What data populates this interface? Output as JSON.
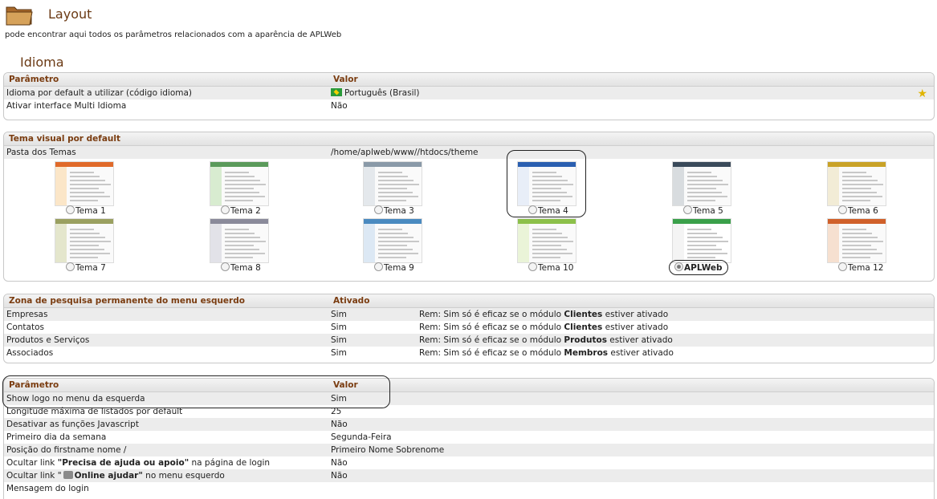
{
  "page": {
    "title": "Layout",
    "description": "pode encontrar aqui todos os parâmetros relacionados com a aparência de APLWeb",
    "section_title": "Idioma"
  },
  "idioma": {
    "header": {
      "param": "Parâmetro",
      "value": "Valor"
    },
    "rows": [
      {
        "label": "Idioma por default a utilizar (código idioma)",
        "value": "Português (Brasil)"
      },
      {
        "label": "Ativar interface Multi Idioma",
        "value": "Não"
      }
    ]
  },
  "tema": {
    "header": "Tema visual por default",
    "folder_label": "Pasta dos Temas",
    "folder_value": "/home/aplweb/www//htdocs/theme",
    "themes": [
      {
        "label": "Tema 1",
        "selected": false,
        "bar": "#e06a2a",
        "side": "#fbe6c8"
      },
      {
        "label": "Tema 2",
        "selected": false,
        "bar": "#5a9a5a",
        "side": "#d8ecd0"
      },
      {
        "label": "Tema 3",
        "selected": false,
        "bar": "#8a9aa8",
        "side": "#e4e8ec"
      },
      {
        "label": "Tema 4",
        "selected": false,
        "bar": "#2a5fb0",
        "side": "#e8eef8"
      },
      {
        "label": "Tema 5",
        "selected": false,
        "bar": "#3a4a5a",
        "side": "#d8dcdf"
      },
      {
        "label": "Tema 6",
        "selected": false,
        "bar": "#c9a227",
        "side": "#f2ecd6"
      },
      {
        "label": "Tema 7",
        "selected": false,
        "bar": "#9aa060",
        "side": "#e4e6cc"
      },
      {
        "label": "Tema 8",
        "selected": false,
        "bar": "#8a8a9a",
        "side": "#e2e2e8"
      },
      {
        "label": "Tema 9",
        "selected": false,
        "bar": "#4a8ac0",
        "side": "#dce8f4"
      },
      {
        "label": "Tema 10",
        "selected": false,
        "bar": "#8cc04a",
        "side": "#eaf4d8"
      },
      {
        "label": "APLWeb",
        "selected": true,
        "bar": "#3aa04a",
        "side": "#f4f4f4"
      },
      {
        "label": "Tema 12",
        "selected": false,
        "bar": "#d0602a",
        "side": "#f6e0d0"
      }
    ]
  },
  "zona": {
    "header": {
      "param": "Zona de pesquisa permanente do menu esquerdo",
      "value": "Ativado"
    },
    "rows": [
      {
        "label": "Empresas",
        "value": "Sim",
        "note_pre": "Rem: Sim só é eficaz se o módulo ",
        "note_bold": "Clientes",
        "note_post": " estiver ativado"
      },
      {
        "label": "Contatos",
        "value": "Sim",
        "note_pre": "Rem: Sim só é eficaz se o módulo ",
        "note_bold": "Clientes",
        "note_post": " estiver ativado"
      },
      {
        "label": "Produtos e Serviços",
        "value": "Sim",
        "note_pre": "Rem: Sim só é eficaz se o módulo ",
        "note_bold": "Produtos",
        "note_post": " estiver ativado"
      },
      {
        "label": "Associados",
        "value": "Sim",
        "note_pre": "Rem: Sim só é eficaz se o módulo ",
        "note_bold": "Membros",
        "note_post": " estiver ativado"
      }
    ]
  },
  "outros": {
    "header": {
      "param": "Parâmetro",
      "value": "Valor"
    },
    "rows": [
      {
        "label": "Show logo no menu da esquerda",
        "value": "Sim"
      },
      {
        "label": "Longitude máxima de listados por default",
        "value": "25"
      },
      {
        "label": "Desativar as funções Javascript",
        "value": "Não"
      },
      {
        "label": "Primeiro dia da semana",
        "value": "Segunda-Feira"
      },
      {
        "label": "Posição do firstname nome /",
        "value": "Primeiro Nome Sobrenome"
      },
      {
        "label_pre": "Ocultar link ",
        "label_bold": "\"Precisa de ajuda ou apoio\"",
        "label_post": " na página de login",
        "value": "Não"
      },
      {
        "label_pre": "Ocultar link \"",
        "label_bold": "Online ajudar\"",
        "label_post": " no menu esquerdo",
        "value": "Não"
      },
      {
        "label": "Mensagem do login",
        "value": ""
      }
    ]
  }
}
